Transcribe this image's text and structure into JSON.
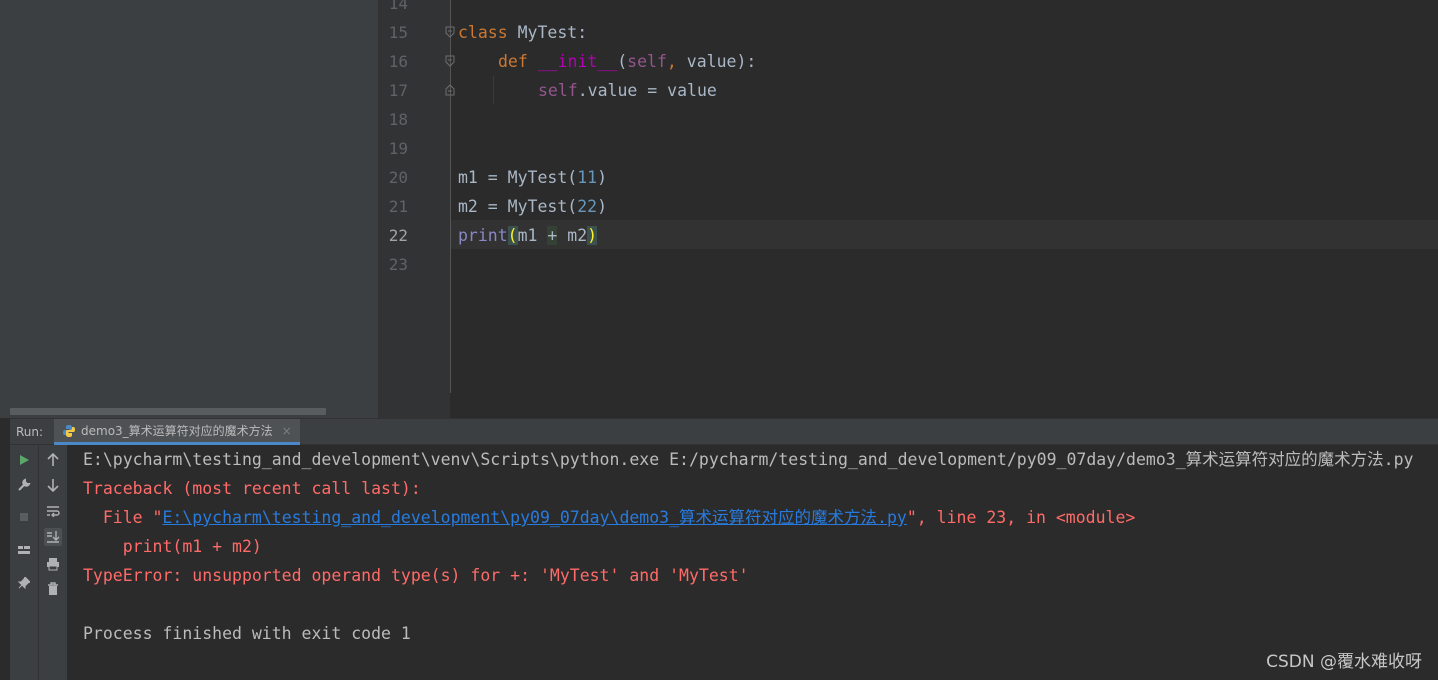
{
  "editor": {
    "line_numbers": [
      "14",
      "15",
      "16",
      "17",
      "18",
      "19",
      "20",
      "21",
      "22",
      "23"
    ],
    "current_line": "22",
    "lines": {
      "l15": {
        "kw_class": "class",
        "name": " MyTest:"
      },
      "l16": {
        "kw_def": "def",
        "sp": " ",
        "magic": "__init__",
        "open": "(",
        "self": "self",
        "comma": ",",
        "rest": " value):"
      },
      "l17": {
        "self": "self",
        "rest": ".value = value"
      },
      "l20": {
        "pre": "m1 = MyTest(",
        "num": "11",
        "post": ")"
      },
      "l21": {
        "pre": "m2 = MyTest(",
        "num": "22",
        "post": ")"
      },
      "l22": {
        "builtin": "print",
        "open": "(",
        "a": "m1 ",
        "op": "+",
        "b": " m2",
        "close": ")"
      }
    }
  },
  "run": {
    "label": "Run:",
    "tab_name": "demo3_算术运算符对应的魔术方法",
    "tab_close": "×"
  },
  "console": {
    "command": "E:\\pycharm\\testing_and_development\\venv\\Scripts\\python.exe E:/pycharm/testing_and_development/py09_07day/demo3_算术运算符对应的魔术方法.py",
    "traceback": "Traceback (most recent call last):",
    "file_prefix": "  File \"",
    "file_link": "E:\\pycharm\\testing_and_development\\py09_07day\\demo3_算术运算符对应的魔术方法.py",
    "file_suffix": "\", line 23, in <module>",
    "code_line": "    print(m1 + m2)",
    "error": "TypeError: unsupported operand type(s) for +: 'MyTest' and 'MyTest'",
    "exit": "Process finished with exit code 1"
  },
  "toolbar_icons": [
    "run-icon",
    "up-arrow-icon",
    "wrench-icon",
    "down-arrow-icon",
    "stop-icon",
    "soft-wrap-icon",
    "layout-icon",
    "scroll-to-end-icon",
    "pin-icon",
    "print-icon",
    "trash-icon"
  ],
  "colors": {
    "error": "#ff6b68",
    "link": "#287bde",
    "keyword": "#cc7832",
    "number": "#6897bb"
  },
  "watermark": "CSDN @覆水难收呀"
}
